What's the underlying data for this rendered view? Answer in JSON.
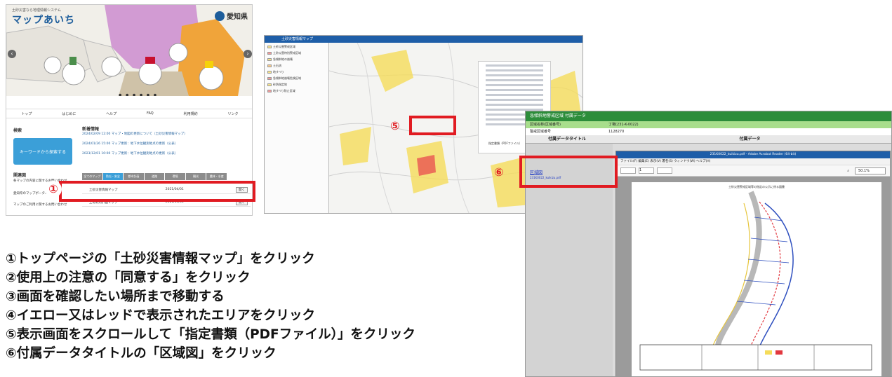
{
  "screens": {
    "portal": {
      "brand_small": "土砂災害なら地理情報システム",
      "brand": "マップあいち",
      "prefecture": "愛知県",
      "nav": [
        "トップ",
        "はじめに",
        "ヘルプ",
        "FAQ",
        "利用規約",
        "リンク"
      ],
      "search_label": "検索",
      "search_button": "キーワードから探索する",
      "news_label": "新着情報",
      "news_items": [
        "2024/02/09 12:00 マップ・地図の更新について（土砂災害情報マップ）",
        "2024/01/26 15:00 マップ更新：地下水位観測地点の更新（公表）",
        "2023/12/01 10:00 マップ更新：地下水位観測地点の更新（公表）"
      ],
      "index_label": "関連図",
      "tabs": [
        "全てのマップ",
        "防災・安全",
        "都市計画",
        "道路",
        "環境",
        "観光",
        "農林・水産"
      ],
      "rows": [
        {
          "title": "土砂災害情報マップ",
          "date": "2021/04/01",
          "button": "開く"
        },
        {
          "title": "土地利用計画マップ",
          "date": "2021/04/01",
          "button": "開く"
        }
      ],
      "side_links": [
        "各マップの内容に関するお問い合わせ",
        "愛知県のマップポータル",
        "マップのご利用に関するお問い合わせ"
      ]
    },
    "sediment_map": {
      "title": "土砂災害情報マップ",
      "layers": [
        "土砂災害警戒区域",
        "土砂災害特別警戒区域",
        "急傾斜地の崩壊",
        "土石流",
        "地すべり",
        "急傾斜地崩壊危険区域",
        "砂防指定地",
        "地すべり防止区域"
      ],
      "popup_item": "指定書類（PDFファイル）"
    },
    "attached_data": {
      "window_title": "急傾斜地警戒区域 付属データ",
      "field1_key": "区域名称(区域番号)",
      "field1_value": "丁場(231-K-0022)",
      "field2_key": "警戒区域番号",
      "field2_value": "1128270",
      "col_title": "付属データタイトル",
      "col_data": "付属データ",
      "zone_link": "区域図",
      "zone_file": "231K0022_kuikizu.pdf",
      "pdf_window_title": "231K0022_kuikizu.pdf - Adobe Acrobat Reader (64-bit)",
      "pdf_menu": "ファイル(F)  編集(E)  表示(V)  署名(S)  ウィンドウ(W)  ヘルプ(H)",
      "pdf_page": "1",
      "pdf_zoom": "50.1%",
      "sheet_title": "土砂災害警戒区域等の指定の公示に係る図書"
    }
  },
  "markers": [
    "①",
    "⑤",
    "⑥"
  ],
  "steps": [
    "①トップページの「土砂災害情報マップ」をクリック",
    "②使用上の注意の「同意する」をクリック",
    "③画面を確認したい場所まで移動する",
    "④イエロー又はレッドで表示されたエリアをクリック",
    "⑤表示画面をスクロールして「指定書類（PDFファイル）」をクリック",
    "⑥付属データタイトルの「区域図」をクリック"
  ],
  "colors": {
    "highlight": "#e11b22",
    "brand_blue": "#1d5d9b",
    "header_green": "#2c8d3a"
  }
}
